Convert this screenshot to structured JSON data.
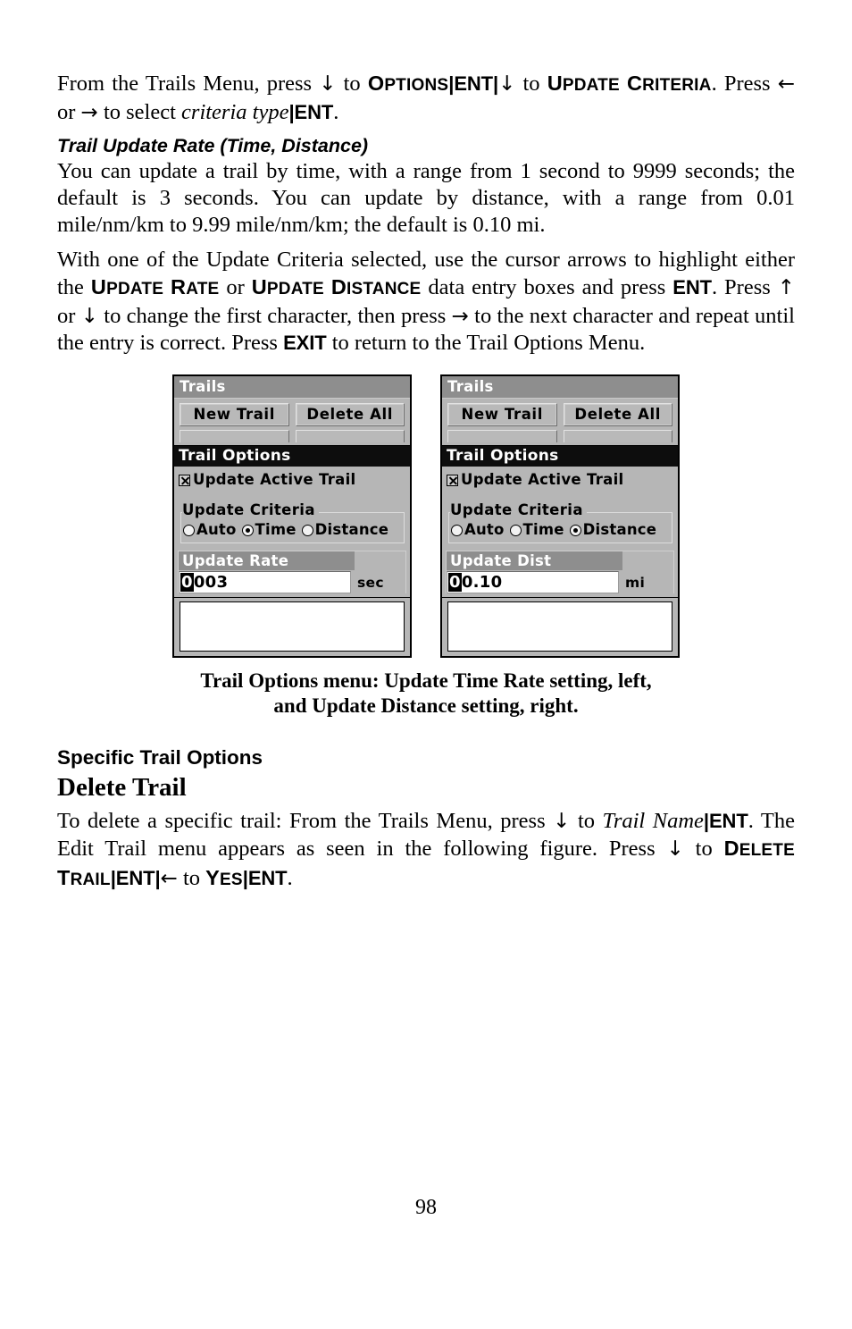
{
  "page": {
    "number": "98"
  },
  "intro": {
    "t1": "From the Trails Menu, press ",
    "arrow_down_1": "↓",
    "t2": " to ",
    "options_o": "O",
    "options_rest": "PTIONS",
    "pipe1": "|",
    "ent1": "ENT",
    "pipe2": "|",
    "arrow_down_2": "↓",
    "t3": " to ",
    "update_u": "U",
    "update_rest": "PDATE",
    "space": " ",
    "criteria_c": "C",
    "criteria_rest": "RITERIA",
    "period1": ".",
    "t4": " Press ",
    "arrow_left": "←",
    "t5": " or ",
    "arrow_right": "→",
    "t6": " to select ",
    "criteria_type": "criteria type",
    "pipe3": "|",
    "ent2": "ENT",
    "period2": "."
  },
  "subheading": {
    "trail_update_rate": "Trail Update Rate (Time, Distance)"
  },
  "para_rate": {
    "text": "You can update a trail by time, with a range from 1 second to 9999 seconds; the default is 3 seconds. You can update by distance, with a range from 0.01 mile/nm/km to 9.99 mile/nm/km; the default is 0.10 mi."
  },
  "para_criteria": {
    "t1": "With one of the Update Criteria selected, use the cursor arrows to highlight either the ",
    "update_u": "U",
    "update_rest": "PDATE",
    "space1": " ",
    "rate_r": "R",
    "rate_rest": "ATE",
    "t2": " or ",
    "update2_u": "U",
    "update2_rest": "PDATE",
    "space2": " ",
    "distance_d": "D",
    "distance_rest": "ISTANCE",
    "t3": " data entry boxes and press ",
    "ent": "ENT",
    "t4": ". Press ",
    "arrow_up": "↑",
    "t5": " or ",
    "arrow_down": "↓",
    "t6": " to change the first character, then press ",
    "arrow_right": "→",
    "t7": " to the next character and repeat until the entry is correct. Press ",
    "exit": "EXIT",
    "t8": " to return to the Trail Options Menu."
  },
  "figure": {
    "caption_line1": "Trail Options menu: Update Time Rate setting, left,",
    "caption_line2": "and Update Distance setting, right.",
    "screens": [
      {
        "title": "Trails",
        "buttons": [
          "New Trail",
          "Delete All"
        ],
        "options_header": "Trail Options",
        "checkbox_label": "Update Active Trail",
        "checkbox_checked": true,
        "criteria_legend": "Update Criteria",
        "radios": [
          {
            "label": "Auto",
            "selected": false
          },
          {
            "label": "Time",
            "selected": true
          },
          {
            "label": "Distance",
            "selected": false
          }
        ],
        "field_label": "Update Rate",
        "field_cursor_char": "0",
        "field_value": "003",
        "field_units": "sec"
      },
      {
        "title": "Trails",
        "buttons": [
          "New Trail",
          "Delete All"
        ],
        "options_header": "Trail Options",
        "checkbox_label": "Update Active Trail",
        "checkbox_checked": true,
        "criteria_legend": "Update Criteria",
        "radios": [
          {
            "label": "Auto",
            "selected": false
          },
          {
            "label": "Time",
            "selected": false
          },
          {
            "label": "Distance",
            "selected": true
          }
        ],
        "field_label": "Update Dist",
        "field_cursor_char": "0",
        "field_value": "0.10",
        "field_units": "mi"
      }
    ]
  },
  "specific": {
    "heading": "Specific Trail Options",
    "subheading": "Delete Trail"
  },
  "para_delete": {
    "t1": "To delete a specific trail: From the Trails Menu, press ",
    "arrow_down_1": "↓",
    "t2": " to ",
    "trail_name": "Trail Name",
    "pipe1": "|",
    "ent1": "ENT",
    "t3": ". The Edit Trail menu appears as seen in the following figure. Press ",
    "arrow_down_2": "↓",
    "t4": " to ",
    "delete_d": "D",
    "delete_rest": "ELETE",
    "space1": " ",
    "trail_t": "T",
    "trail_rest": "RAIL",
    "pipe2": "|",
    "ent2": "ENT",
    "pipe3": "|",
    "arrow_left": "←",
    "t5": " to ",
    "yes_y": "Y",
    "yes_rest": "ES",
    "pipe4": "|",
    "ent3": "ENT",
    "period": "."
  },
  "colors": {
    "lcd_background": "#b6b6b6",
    "lcd_titlebar": "#8e8e8e",
    "lcd_header_selected": "#0d0d0d",
    "lcd_field_white": "#ffffff",
    "text": "#000000"
  }
}
